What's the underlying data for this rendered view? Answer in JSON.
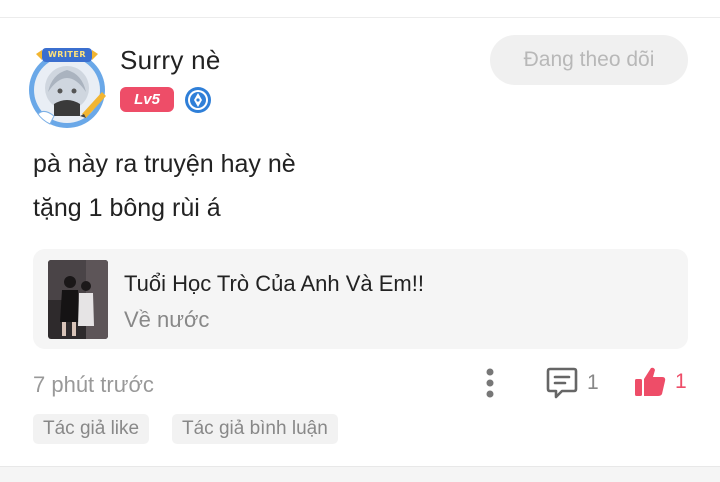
{
  "user": {
    "name": "Surry nè",
    "level": "Lv5",
    "avatar_frame_text": "WRITER"
  },
  "follow_button": {
    "label": "Đang theo dõi"
  },
  "comment": {
    "lines": [
      "pà này ra truyện hay nè",
      "tặng 1 bông rùi á"
    ]
  },
  "story": {
    "title": "Tuổi Học Trò Của Anh Và Em!!",
    "subtitle": "Về nước"
  },
  "meta": {
    "timestamp": "7 phút trước",
    "reply_count": "1",
    "like_count": "1"
  },
  "tags": [
    "Tác giả like",
    "Tác giả bình luận"
  ],
  "colors": {
    "accent": "#ee4d68",
    "muted_text": "#999999",
    "card_bg": "#f5f5f5",
    "writer_badge": "#2f7fd8"
  },
  "icons": [
    "pen-badge-icon",
    "more-vertical-icon",
    "comment-icon",
    "thumbs-up-icon"
  ]
}
